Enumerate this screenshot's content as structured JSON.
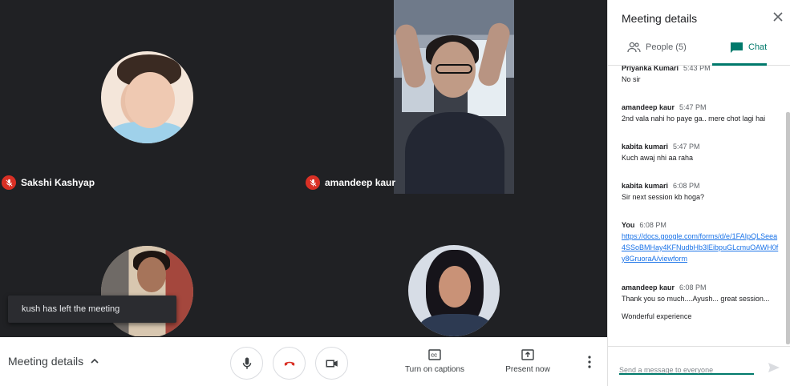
{
  "tiles": [
    {
      "name": "Sakshi Kashyap",
      "muted": true
    },
    {
      "name": "amandeep kaur",
      "muted": true
    },
    {
      "name": "",
      "muted": false
    },
    {
      "name": "",
      "muted": false
    }
  ],
  "toast": "kush has left the meeting",
  "bottombar": {
    "meeting_details_label": "Meeting details",
    "captions_label": "Turn on captions",
    "present_label": "Present now"
  },
  "panel": {
    "title": "Meeting details",
    "people_tab": "People (5)",
    "chat_tab": "Chat",
    "messages": [
      {
        "sender": "Priyanka Kumari",
        "time": "5:43 PM",
        "lines": [
          "No sir"
        ]
      },
      {
        "sender": "amandeep kaur",
        "time": "5:47 PM",
        "lines": [
          "2nd vala nahi ho paye ga.. mere chot lagi hai"
        ]
      },
      {
        "sender": "kabita kumari",
        "time": "5:47 PM",
        "lines": [
          "Kuch awaj nhi aa raha"
        ]
      },
      {
        "sender": "kabita kumari",
        "time": "6:08 PM",
        "lines": [
          "Sir next session kb hoga?"
        ]
      },
      {
        "sender": "You",
        "time": "6:08 PM",
        "link": "https://docs.google.com/forms/d/e/1FAIpQLSeea4SSoBMHay4KFNudbHb3lEibpuGLcmuOAWH0fy8GruoraA/viewform"
      },
      {
        "sender": "amandeep kaur",
        "time": "6:08 PM",
        "lines": [
          "Thank you so much....Ayush... great session...",
          "Wonderful experience"
        ]
      }
    ],
    "input_placeholder": "Send a message to everyone"
  },
  "colors": {
    "accent": "#00796b",
    "end_call": "#d93025",
    "link": "#1a73e8",
    "dark_bg": "#202124"
  }
}
